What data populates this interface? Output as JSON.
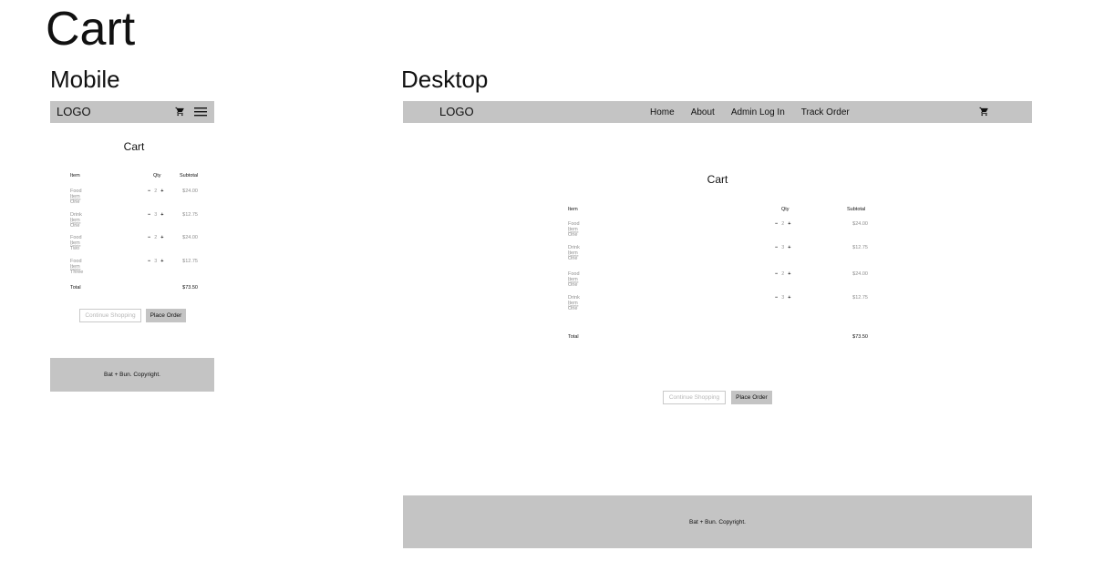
{
  "page": {
    "title": "Cart"
  },
  "sections": {
    "mobile": "Mobile",
    "desktop": "Desktop"
  },
  "header": {
    "logo": "LOGO",
    "nav": [
      "Home",
      "About",
      "Admin Log In",
      "Track Order"
    ]
  },
  "cart": {
    "title": "Cart",
    "columns": {
      "item": "Item",
      "qty": "Qty",
      "subtotal": "Subtotal"
    },
    "delete_label": "Delete",
    "mobile_items": [
      {
        "name": "Food Item One",
        "qty": "2",
        "subtotal": "$24.00"
      },
      {
        "name": "Drink Item One",
        "qty": "3",
        "subtotal": "$12.75"
      },
      {
        "name": "Food Item Two",
        "qty": "2",
        "subtotal": "$24.00"
      },
      {
        "name": "Food Item Three",
        "qty": "3",
        "subtotal": "$12.75"
      }
    ],
    "desktop_items": [
      {
        "name": "Food Item One",
        "qty": "2",
        "subtotal": "$24.00"
      },
      {
        "name": "Drink Item One",
        "qty": "3",
        "subtotal": "$12.75"
      },
      {
        "name": "Food Item One",
        "qty": "2",
        "subtotal": "$24.00"
      },
      {
        "name": "Drink Item One",
        "qty": "3",
        "subtotal": "$12.75"
      }
    ],
    "minus": "−",
    "plus": "+",
    "total_label": "Total",
    "total_value": "$73.50",
    "continue_label": "Continue Shopping",
    "place_order_label": "Place Order"
  },
  "footer": {
    "text": "Bat + Bun. Copyright."
  },
  "icons": {
    "cart": "cart-icon",
    "menu": "menu-icon"
  },
  "colors": {
    "bar": "#c4c4c4",
    "muted": "#8f8f8f"
  }
}
